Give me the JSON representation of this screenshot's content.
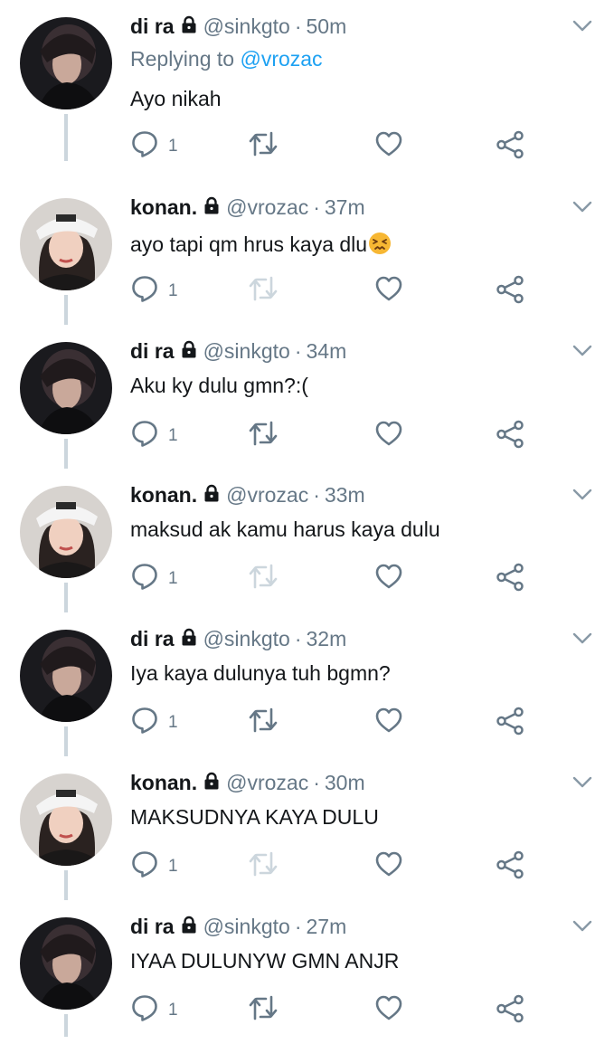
{
  "colors": {
    "name": "#14171a",
    "muted": "#657786",
    "link": "#1da1f2",
    "icon": "#657786",
    "thread_line": "#ccd6dd"
  },
  "icons": {
    "lock": "lock-icon",
    "chevron": "chevron-down-icon",
    "reply": "reply-icon",
    "retweet": "retweet-icon",
    "like": "heart-icon",
    "share": "share-icon",
    "emoji": "persevering-face-emoji"
  },
  "tweets": [
    {
      "name": "di ra",
      "handle": "@sinkgto",
      "separator": "·",
      "time": "50m",
      "replying_prefix": "Replying to",
      "replying_to": "@vrozac",
      "text": "Ayo nikah",
      "reply_count": "1",
      "avatar": "dira"
    },
    {
      "name": "konan.",
      "handle": "@vrozac",
      "separator": "·",
      "time": "37m",
      "text": "ayo tapi qm hrus kaya dlu",
      "reply_count": "1",
      "avatar": "konan"
    },
    {
      "name": "di ra",
      "handle": "@sinkgto",
      "separator": "·",
      "time": "34m",
      "text": "Aku ky dulu gmn?:(",
      "reply_count": "1",
      "avatar": "dira"
    },
    {
      "name": "konan.",
      "handle": "@vrozac",
      "separator": "·",
      "time": "33m",
      "text": "maksud ak kamu harus kaya dulu",
      "reply_count": "1",
      "avatar": "konan"
    },
    {
      "name": "di ra",
      "handle": "@sinkgto",
      "separator": "·",
      "time": "32m",
      "text": "Iya kaya dulunya tuh bgmn?",
      "reply_count": "1",
      "avatar": "dira"
    },
    {
      "name": "konan.",
      "handle": "@vrozac",
      "separator": "·",
      "time": "30m",
      "text": "MAKSUDNYA KAYA DULU",
      "reply_count": "1",
      "avatar": "konan"
    },
    {
      "name": "di ra",
      "handle": "@sinkgto",
      "separator": "·",
      "time": "27m",
      "text": "IYAA DULUNYW GMN ANJR",
      "reply_count": "1",
      "avatar": "dira"
    }
  ]
}
